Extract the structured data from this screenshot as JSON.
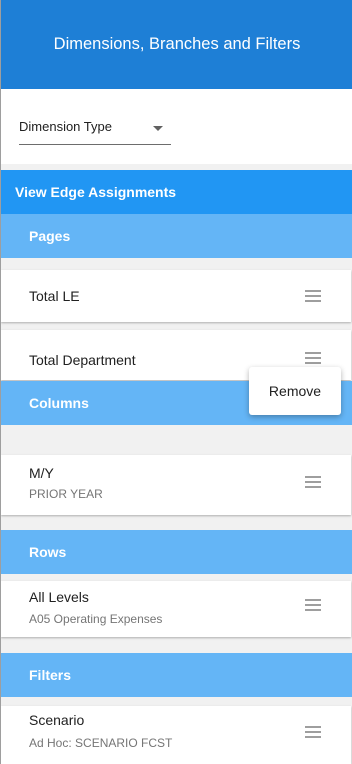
{
  "header": {
    "title": "Dimensions, Branches and Filters"
  },
  "dimension_select": {
    "label": "Dimension Type"
  },
  "view_edge": {
    "label": "View Edge Assignments"
  },
  "sections": {
    "pages": {
      "label": "Pages",
      "items": [
        {
          "title": "Total LE"
        },
        {
          "title": "Total Department"
        }
      ]
    },
    "columns": {
      "label": "Columns",
      "items": [
        {
          "title": "M/Y",
          "subtitle": "PRIOR YEAR"
        }
      ]
    },
    "rows": {
      "label": "Rows",
      "items": [
        {
          "title": "All Levels",
          "subtitle": "A05 Operating Expenses"
        }
      ]
    },
    "filters": {
      "label": "Filters",
      "items": [
        {
          "title": "Scenario",
          "subtitle": "Ad Hoc: SCENARIO FCST"
        }
      ]
    }
  },
  "context_menu": {
    "remove_label": "Remove"
  }
}
